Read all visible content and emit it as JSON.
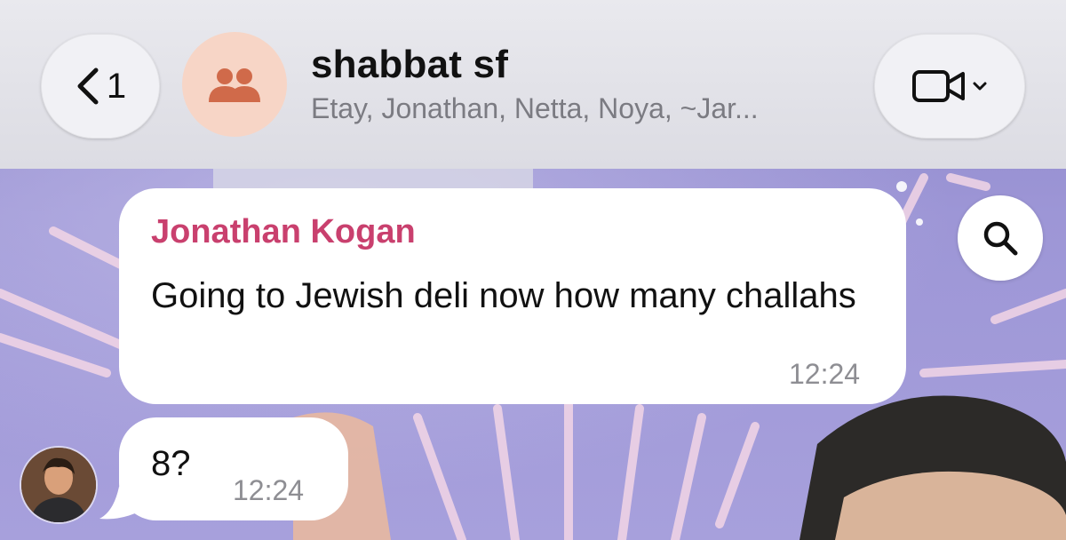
{
  "header": {
    "back_count": "1",
    "title": "shabbat sf",
    "subtitle": "Etay, Jonathan, Netta, Noya, ~Jar..."
  },
  "icons": {
    "back": "chevron-left-icon",
    "group": "group-people-icon",
    "video": "video-camera-icon",
    "dropdown": "chevron-down-icon",
    "search": "search-icon"
  },
  "messages": [
    {
      "sender": "Jonathan Kogan",
      "text": "Going to Jewish deli now how many challahs",
      "time": "12:24"
    },
    {
      "text": "8?",
      "time": "12:24"
    }
  ],
  "colors": {
    "sender_name": "#c9406e",
    "group_avatar_bg": "#f7d5c6",
    "group_icon": "#d06a4a"
  }
}
